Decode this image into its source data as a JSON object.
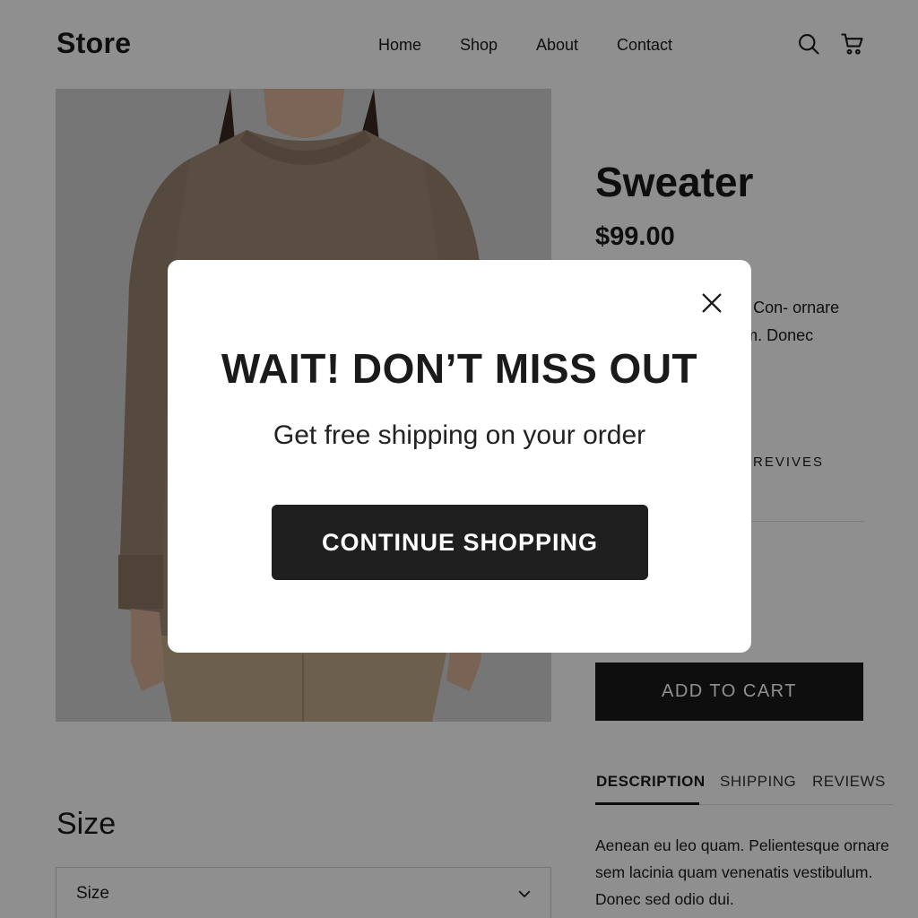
{
  "header": {
    "logo": "Store",
    "nav": [
      "Home",
      "Shop",
      "About",
      "Contact"
    ],
    "icons": [
      "search-icon",
      "cart-icon"
    ]
  },
  "product": {
    "title": "Sweater",
    "price": "$99.00",
    "short_description": "Aenean eu leo quam. Con- ornare sem lacinia vestibulum. Donec",
    "reviews_link": "REVIVES",
    "add_to_cart_label": "ADD TO CART",
    "image": "woman-wearing-beige-sweater"
  },
  "tabs": [
    {
      "label": "DESCRIPTION",
      "active": true
    },
    {
      "label": "SHIPPING",
      "active": false
    },
    {
      "label": "REVIEWS",
      "active": false
    }
  ],
  "description": "Aenean eu leo quam. Pelientesque ornare sem lacinia quam venenatis vestibulum. Donec sed odio dui.",
  "size": {
    "heading": "Size",
    "select_value": "Size"
  },
  "modal": {
    "title": "WAIT! DON’T MISS OUT",
    "subtitle": "Get free shipping on your order",
    "cta_label": "CONTINUE SHOPPING"
  },
  "colors": {
    "overlay": "rgba(0,0,0,0.44)",
    "button_dark": "#1f1f1f",
    "sweater": "#a08a74"
  }
}
